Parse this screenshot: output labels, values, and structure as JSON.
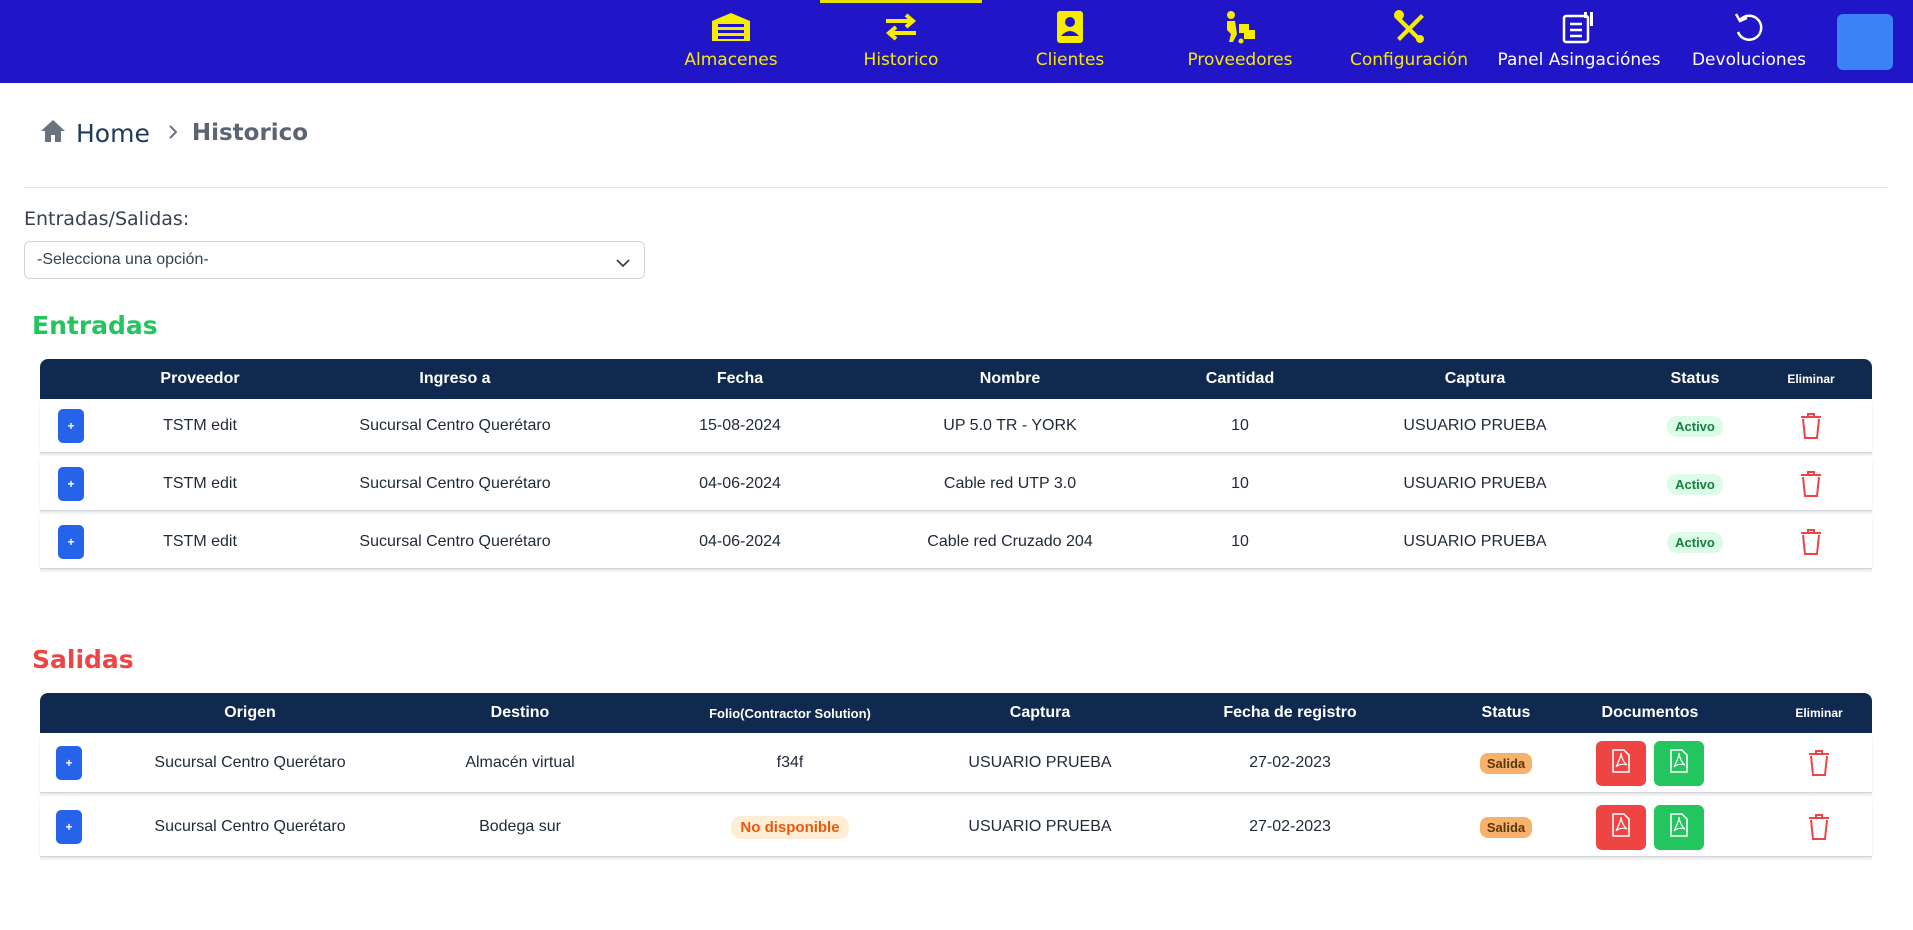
{
  "nav": {
    "items": [
      {
        "label": "Almacenes",
        "icon": "warehouse-icon"
      },
      {
        "label": "Historico",
        "icon": "swap-arrows-icon"
      },
      {
        "label": "Clientes",
        "icon": "contacts-icon"
      },
      {
        "label": "Proveedores",
        "icon": "supplier-dolly-icon"
      },
      {
        "label": "Configuración",
        "icon": "tools-icon"
      },
      {
        "label": "Panel Asingaciónes",
        "icon": "assignment-panel-icon"
      },
      {
        "label": "Devoluciones",
        "icon": "undo-icon"
      }
    ],
    "active": "Historico",
    "accent_color": "#f5ec00",
    "bg_color": "#2015c7"
  },
  "breadcrumb": {
    "home": "Home",
    "current": "Historico"
  },
  "filter": {
    "label": "Entradas/Salidas:",
    "value": "-Selecciona una opción-"
  },
  "entradas": {
    "title": "Entradas",
    "headers": [
      "Proveedor",
      "Ingreso a",
      "Fecha",
      "Nombre",
      "Cantidad",
      "Captura",
      "Status",
      "Eliminar"
    ],
    "rows": [
      {
        "proveedor": "TSTM edit",
        "ingreso": "Sucursal Centro Querétaro",
        "fecha": "15-08-2024",
        "nombre": "UP 5.0 TR - YORK",
        "cantidad": "10",
        "captura": "USUARIO PRUEBA",
        "status": "Activo"
      },
      {
        "proveedor": "TSTM edit",
        "ingreso": "Sucursal Centro Querétaro",
        "fecha": "04-06-2024",
        "nombre": "Cable red UTP 3.0",
        "cantidad": "10",
        "captura": "USUARIO PRUEBA",
        "status": "Activo"
      },
      {
        "proveedor": "TSTM edit",
        "ingreso": "Sucursal Centro Querétaro",
        "fecha": "04-06-2024",
        "nombre": "Cable red Cruzado 204",
        "cantidad": "10",
        "captura": "USUARIO PRUEBA",
        "status": "Activo"
      }
    ],
    "expand_label": "+"
  },
  "salidas": {
    "title": "Salidas",
    "headers": [
      "Origen",
      "Destino",
      "Folio(Contractor Solution)",
      "Captura",
      "Fecha de registro",
      "Status",
      "Documentos",
      "Eliminar"
    ],
    "rows": [
      {
        "origen": "Sucursal Centro Querétaro",
        "destino": "Almacén virtual",
        "folio": "f34f",
        "captura": "USUARIO PRUEBA",
        "fecha": "27-02-2023",
        "status": "Salida"
      },
      {
        "origen": "Sucursal Centro Querétaro",
        "destino": "Bodega sur",
        "folio": "No disponible",
        "captura": "USUARIO PRUEBA",
        "fecha": "27-02-2023",
        "status": "Salida"
      }
    ],
    "expand_label": "+"
  }
}
